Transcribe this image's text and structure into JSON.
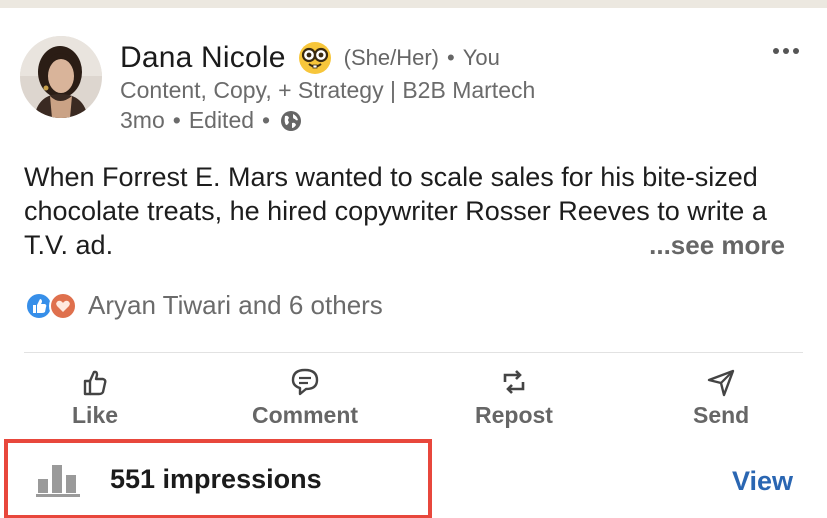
{
  "author": {
    "name": "Dana Nicole",
    "pronouns": "(She/Her)",
    "separator": "•",
    "relation": "You",
    "headline": "Content, Copy, + Strategy | B2B Martech",
    "time_ago": "3mo",
    "edited_label": "Edited",
    "visibility_icon": "globe-icon",
    "status_emoji_icon": "nerd-face-icon"
  },
  "post": {
    "text": "When Forrest E. Mars wanted to scale sales for his bite-sized chocolate treats, he hired copywriter Rosser Reeves to write a T.V. ad.",
    "see_more_label": "...see more"
  },
  "reactions": {
    "icons": [
      "like-reaction-icon",
      "love-reaction-icon"
    ],
    "summary": "Aryan Tiwari and 6 others"
  },
  "actions": [
    {
      "label": "Like",
      "icon": "thumbs-up-icon"
    },
    {
      "label": "Comment",
      "icon": "comment-icon"
    },
    {
      "label": "Repost",
      "icon": "repost-icon"
    },
    {
      "label": "Send",
      "icon": "send-icon"
    }
  ],
  "analytics": {
    "impressions_label": "551 impressions",
    "view_label": "View",
    "icon": "bar-chart-icon",
    "highlight_color": "#e8473c"
  },
  "colors": {
    "link": "#2a66b2",
    "secondary_text": "#666666",
    "primary_text": "#1b1b1b"
  }
}
